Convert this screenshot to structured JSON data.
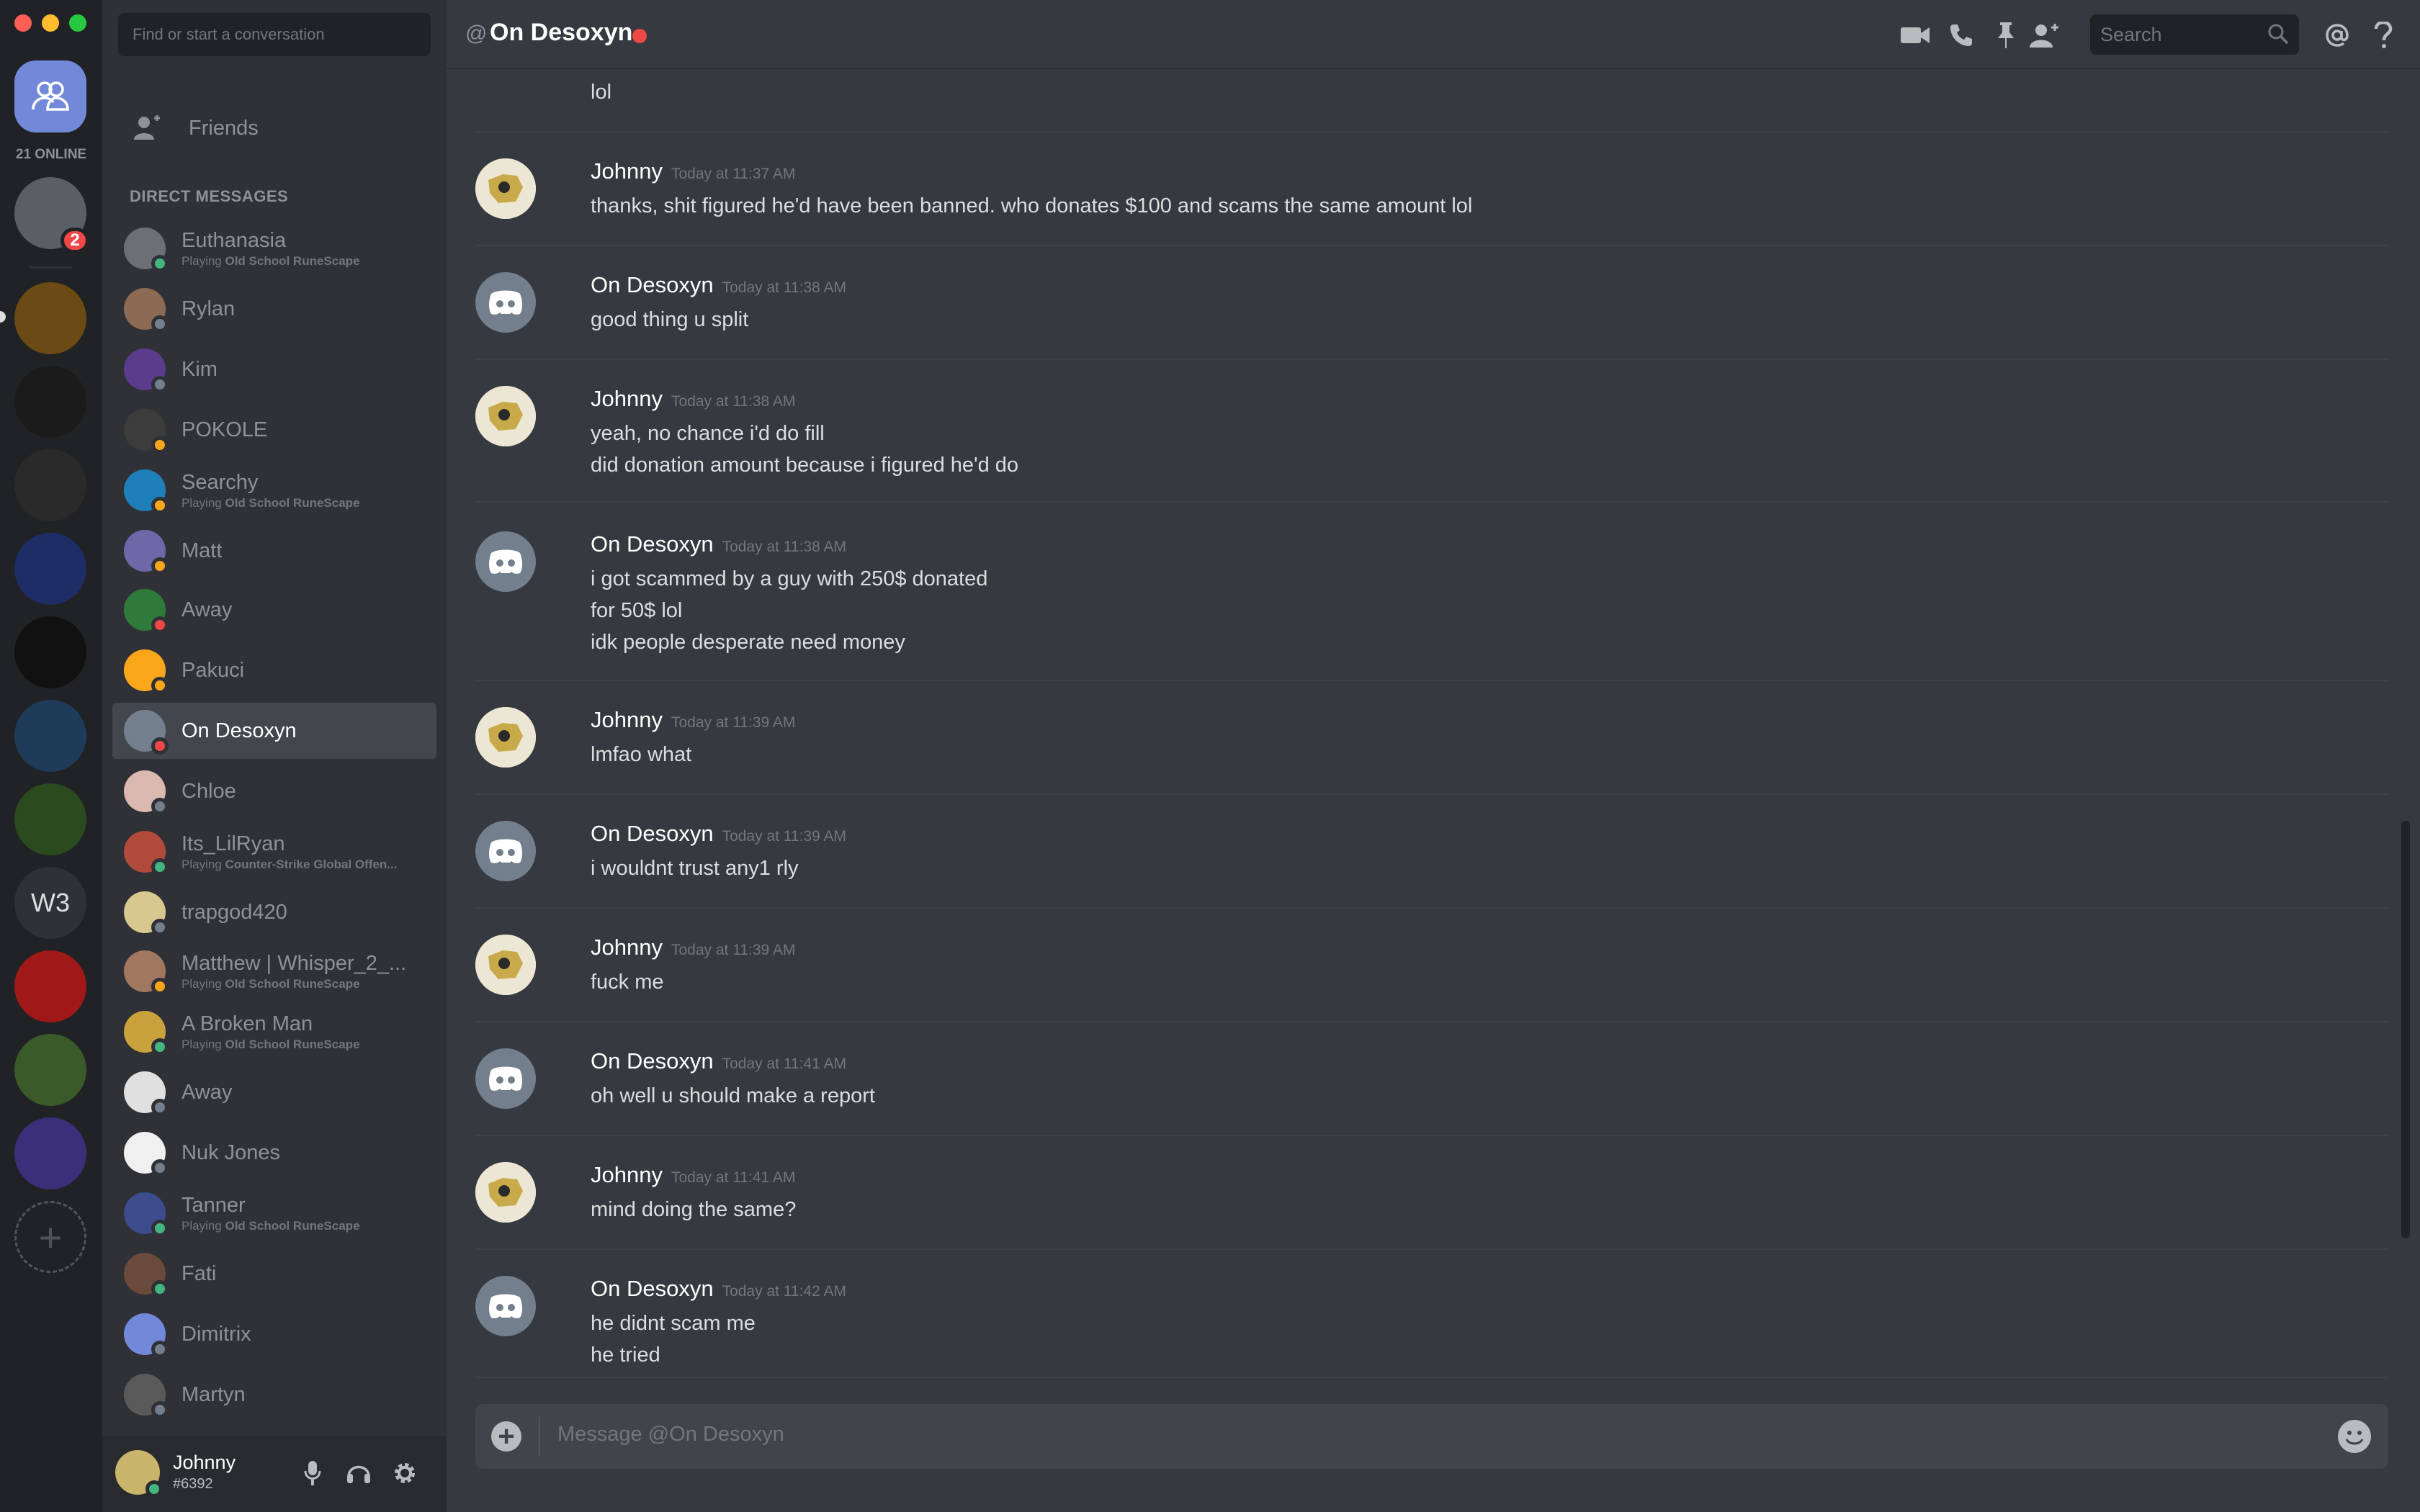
{
  "rail": {
    "online_count": "21 ONLINE",
    "badge_count": "2",
    "w3_label": "W3",
    "guild_colors": [
      "#5a5f66",
      "#6b4a14",
      "#1b1b1b",
      "#2a2a2a",
      "#1e2d66",
      "#111111",
      "#1e3c5a",
      "#2b4a1e",
      "#a01818",
      "#3a5a2a",
      "#3b2f7a"
    ]
  },
  "sidebar": {
    "search_placeholder": "Find or start a conversation",
    "friends_label": "Friends",
    "dm_header": "DIRECT MESSAGES",
    "dms": [
      {
        "name": "Euthanasia",
        "activity_prefix": "Playing ",
        "activity": "Old School RuneScape",
        "status": "online",
        "color": "#6d6f73"
      },
      {
        "name": "Rylan",
        "activity_prefix": "",
        "activity": "",
        "status": "offline",
        "color": "#8c6a54"
      },
      {
        "name": "Kim",
        "activity_prefix": "",
        "activity": "",
        "status": "offline",
        "color": "#5b3c8c"
      },
      {
        "name": "POKOLE",
        "activity_prefix": "",
        "activity": "",
        "status": "idle",
        "color": "#3c3c3c"
      },
      {
        "name": "Searchy",
        "activity_prefix": "Playing ",
        "activity": "Old School RuneScape",
        "status": "idle",
        "color": "#1f7fb8"
      },
      {
        "name": "Matt",
        "activity_prefix": "",
        "activity": "",
        "status": "idle",
        "color": "#6e68a8"
      },
      {
        "name": "Away",
        "activity_prefix": "",
        "activity": "",
        "status": "dnd",
        "color": "#2d7a3a"
      },
      {
        "name": "Pakuci",
        "activity_prefix": "",
        "activity": "",
        "status": "idle",
        "color": "#faa61a"
      },
      {
        "name": "On Desoxyn",
        "activity_prefix": "",
        "activity": "",
        "status": "dnd",
        "color": "#747f8d"
      },
      {
        "name": "Chloe",
        "activity_prefix": "",
        "activity": "",
        "status": "offline",
        "color": "#d9b9b0"
      },
      {
        "name": "Its_LilRyan",
        "activity_prefix": "Playing ",
        "activity": "Counter-Strike Global Offen...",
        "status": "online",
        "color": "#b04a3a"
      },
      {
        "name": "trapgod420",
        "activity_prefix": "",
        "activity": "",
        "status": "offline",
        "color": "#d8c890"
      },
      {
        "name": "Matthew | Whisper_2_...",
        "activity_prefix": "Playing ",
        "activity": "Old School RuneScape",
        "status": "idle",
        "color": "#a07860"
      },
      {
        "name": "A Broken Man",
        "activity_prefix": "Playing ",
        "activity": "Old School RuneScape",
        "status": "online",
        "color": "#c9a23c"
      },
      {
        "name": "Away",
        "activity_prefix": "",
        "activity": "",
        "status": "offline",
        "color": "#e0e0e0"
      },
      {
        "name": "Nuk Jones",
        "activity_prefix": "",
        "activity": "",
        "status": "offline",
        "color": "#f0f0f0"
      },
      {
        "name": "Tanner",
        "activity_prefix": "Playing ",
        "activity": "Old School RuneScape",
        "status": "online",
        "color": "#3c4c8c"
      },
      {
        "name": "Fati",
        "activity_prefix": "",
        "activity": "",
        "status": "online",
        "color": "#6a4a3a"
      },
      {
        "name": "Dimitrix",
        "activity_prefix": "",
        "activity": "",
        "status": "offline",
        "color": "#7289da"
      },
      {
        "name": "Martyn",
        "activity_prefix": "",
        "activity": "",
        "status": "offline",
        "color": "#5a5a5a"
      }
    ]
  },
  "user_panel": {
    "username": "Johnny",
    "tag": "#6392",
    "status": "online"
  },
  "chat": {
    "at_symbol": "@",
    "title": "On Desoxyn",
    "search_placeholder": "Search",
    "partial_top_text": "lol",
    "messages": [
      {
        "author": "Johnny",
        "time": "Today at 11:37 AM",
        "lines": [
          "thanks, shit figured he'd have been banned. who donates $100 and scams the same amount lol"
        ],
        "avatar": "johnny"
      },
      {
        "author": "On Desoxyn",
        "time": "Today at 11:38 AM",
        "lines": [
          "good thing u split"
        ],
        "avatar": "default"
      },
      {
        "author": "Johnny",
        "time": "Today at 11:38 AM",
        "lines": [
          "yeah, no chance i'd do fill",
          "did donation amount because i figured he'd do"
        ],
        "avatar": "johnny"
      },
      {
        "author": "On Desoxyn",
        "time": "Today at 11:38 AM",
        "lines": [
          "i got scammed by a guy with 250$ donated",
          "for 50$ lol",
          "idk people desperate need money"
        ],
        "avatar": "default"
      },
      {
        "author": "Johnny",
        "time": "Today at 11:39 AM",
        "lines": [
          "lmfao what"
        ],
        "avatar": "johnny"
      },
      {
        "author": "On Desoxyn",
        "time": "Today at 11:39 AM",
        "lines": [
          "i wouldnt trust any1 rly"
        ],
        "avatar": "default"
      },
      {
        "author": "Johnny",
        "time": "Today at 11:39 AM",
        "lines": [
          "fuck me"
        ],
        "avatar": "johnny"
      },
      {
        "author": "On Desoxyn",
        "time": "Today at 11:41 AM",
        "lines": [
          "oh well u should make a report"
        ],
        "avatar": "default"
      },
      {
        "author": "Johnny",
        "time": "Today at 11:41 AM",
        "lines": [
          "mind doing the same?"
        ],
        "avatar": "johnny"
      },
      {
        "author": "On Desoxyn",
        "time": "Today at 11:42 AM",
        "lines": [
          "he didnt scam me",
          "he tried"
        ],
        "avatar": "default"
      }
    ],
    "composer_placeholder": "Message @On Desoxyn"
  },
  "colors": {
    "accent": "#7289da",
    "online": "#43b581",
    "idle": "#faa61a",
    "dnd": "#f04747",
    "offline": "#747f8d"
  },
  "icons": {
    "header": [
      "video-call-icon",
      "voice-call-icon",
      "pin-icon",
      "add-friend-icon",
      "mention-icon",
      "help-icon"
    ],
    "user_panel": [
      "microphone-icon",
      "headphones-icon",
      "settings-icon"
    ]
  }
}
